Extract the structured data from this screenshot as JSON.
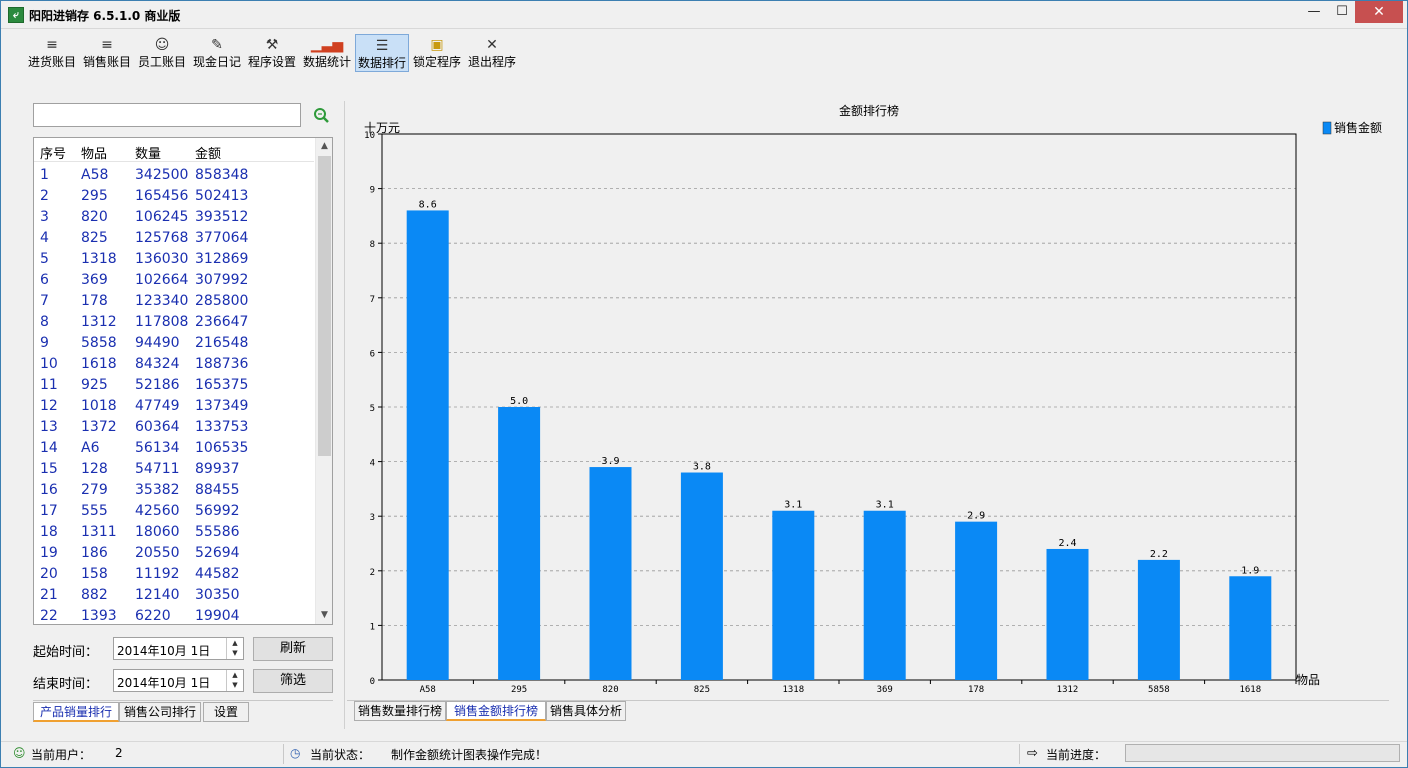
{
  "window": {
    "title": "阳阳进销存 6.5.1.0 商业版",
    "min_label": "—",
    "max_label": "☐",
    "close_label": "✕"
  },
  "toolbar": [
    {
      "label": "进货账目",
      "icon": "list-indent-icon",
      "glyph": "≡"
    },
    {
      "label": "销售账目",
      "icon": "list-outdent-icon",
      "glyph": "≡"
    },
    {
      "label": "员工账目",
      "icon": "people-icon",
      "glyph": "☺"
    },
    {
      "label": "现金日记",
      "icon": "notebook-pen-icon",
      "glyph": "✎"
    },
    {
      "label": "程序设置",
      "icon": "tools-icon",
      "glyph": "⚒"
    },
    {
      "label": "数据统计",
      "icon": "bar-chart-icon",
      "glyph": "▁▃▅"
    },
    {
      "label": "数据排行",
      "icon": "numbered-list-icon",
      "glyph": "☰"
    },
    {
      "label": "锁定程序",
      "icon": "lock-icon",
      "glyph": "▣"
    },
    {
      "label": "退出程序",
      "icon": "close-x-icon",
      "glyph": "✕"
    }
  ],
  "search": {
    "value": "",
    "placeholder": ""
  },
  "list": {
    "headers": [
      "序号",
      "物品",
      "数量",
      "金额"
    ],
    "rows": [
      [
        "1",
        "A58",
        "342500",
        "858348"
      ],
      [
        "2",
        "295",
        "165456",
        "502413"
      ],
      [
        "3",
        "820",
        "106245",
        "393512"
      ],
      [
        "4",
        "825",
        "125768",
        "377064"
      ],
      [
        "5",
        "1318",
        "136030",
        "312869"
      ],
      [
        "6",
        "369",
        "102664",
        "307992"
      ],
      [
        "7",
        "178",
        "123340",
        "285800"
      ],
      [
        "8",
        "1312",
        "117808",
        "236647"
      ],
      [
        "9",
        "5858",
        "94490",
        "216548"
      ],
      [
        "10",
        "1618",
        "84324",
        "188736"
      ],
      [
        "11",
        "925",
        "52186",
        "165375"
      ],
      [
        "12",
        "1018",
        "47749",
        "137349"
      ],
      [
        "13",
        "1372",
        "60364",
        "133753"
      ],
      [
        "14",
        "A6",
        "56134",
        "106535"
      ],
      [
        "15",
        "128",
        "54711",
        "89937"
      ],
      [
        "16",
        "279",
        "35382",
        "88455"
      ],
      [
        "17",
        "555",
        "42560",
        "56992"
      ],
      [
        "18",
        "1311",
        "18060",
        "55586"
      ],
      [
        "19",
        "186",
        "20550",
        "52694"
      ],
      [
        "20",
        "158",
        "11192",
        "44582"
      ],
      [
        "21",
        "882",
        "12140",
        "30350"
      ],
      [
        "22",
        "1393",
        "6220",
        "19904"
      ]
    ]
  },
  "filters": {
    "start_label": "起始时间：",
    "start_value": "2014年10月 1日",
    "end_label": "结束时间：",
    "end_value": "2014年10月 1日",
    "refresh_label": "刷新",
    "filter_label": "筛选"
  },
  "left_tabs": [
    "产品销量排行",
    "销售公司排行",
    "设置"
  ],
  "chart_tabs": [
    "销售数量排行榜",
    "销售金额排行榜",
    "销售具体分析"
  ],
  "status": {
    "user_label": "当前用户：",
    "user_value": "2",
    "state_label": "当前状态：",
    "state_value": "制作金额统计图表操作完成！",
    "progress_label": "当前进度：",
    "progress_value": 0
  },
  "colors": {
    "bar": "#0a89f5",
    "accent_tab": "#f0a030",
    "list_text": "#1a2fb0"
  },
  "chart_data": {
    "type": "bar",
    "title": "金额排行榜",
    "ylabel": "十万元",
    "xlabel": "物品",
    "categories": [
      "A58",
      "295",
      "820",
      "825",
      "1318",
      "369",
      "178",
      "1312",
      "5858",
      "1618"
    ],
    "series": [
      {
        "name": "销售金额",
        "values": [
          8.6,
          5.0,
          3.9,
          3.8,
          3.1,
          3.1,
          2.9,
          2.4,
          2.2,
          1.9
        ]
      }
    ],
    "value_labels": [
      "8.6",
      "5.0",
      "3.9",
      "3.8",
      "3.1",
      "3.1",
      "2.9",
      "2.4",
      "2.2",
      "1.9"
    ],
    "ylim": [
      0,
      10
    ],
    "yticks": [
      0,
      1,
      2,
      3,
      4,
      5,
      6,
      7,
      8,
      9,
      10
    ],
    "grid": true,
    "legend": "top-right"
  }
}
